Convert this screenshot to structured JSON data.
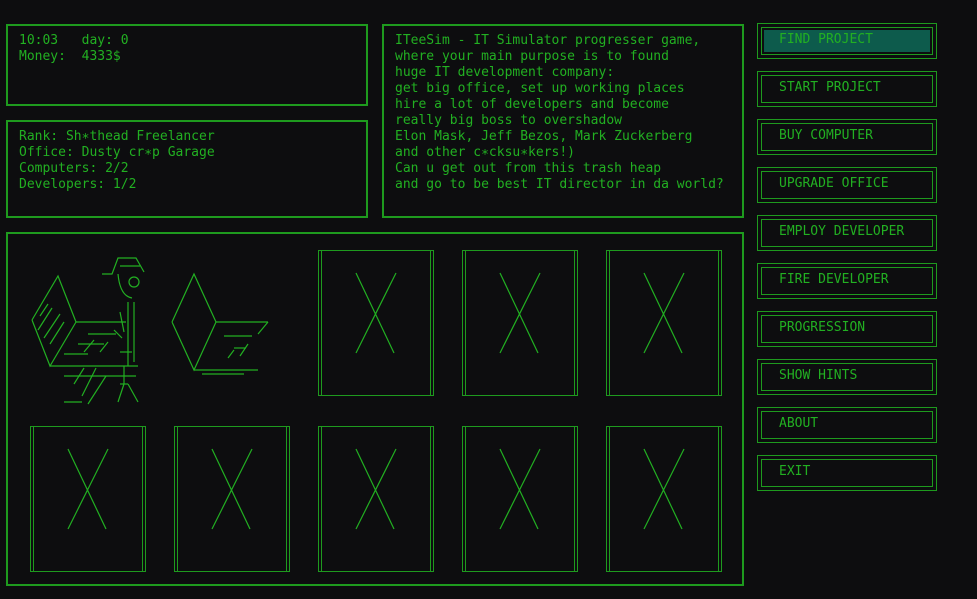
{
  "status": {
    "time": "10:03",
    "day_label": "day: 0",
    "money_label": "Money:",
    "money_value": "4333$"
  },
  "info": {
    "rank": "Rank: Sh∗thead Freelancer",
    "office": "Office: Dusty cr∗p Garage",
    "computers": "Computers: 2/2",
    "developers": "Developers: 1/2"
  },
  "description": [
    "ITeeSim - IT Simulator progresser game,",
    "where your main purpose is to found",
    "huge IT development company:",
    "get big office, set up working places",
    "hire a lot of developers and become",
    "really big boss to overshadow",
    "Elon Mask, Jeff Bezos, Mark Zuckerberg",
    "and other c∗cksu∗kers!)",
    "Can u get out from this trash heap",
    "and go to be best IT director in da world?"
  ],
  "menu": [
    {
      "label": "FIND PROJECT",
      "selected": true
    },
    {
      "label": "START PROJECT",
      "selected": false
    },
    {
      "label": "BUY COMPUTER",
      "selected": false
    },
    {
      "label": "UPGRADE OFFICE",
      "selected": false
    },
    {
      "label": "EMPLOY DEVELOPER",
      "selected": false
    },
    {
      "label": "FIRE DEVELOPER",
      "selected": false
    },
    {
      "label": "PROGRESSION",
      "selected": false
    },
    {
      "label": "SHOW HINTS",
      "selected": false
    },
    {
      "label": "ABOUT",
      "selected": false
    },
    {
      "label": "EXIT",
      "selected": false
    }
  ],
  "office_slots": [
    {
      "state": "developer-at-computer"
    },
    {
      "state": "empty-computer"
    },
    {
      "state": "locked"
    },
    {
      "state": "locked"
    },
    {
      "state": "locked"
    },
    {
      "state": "locked"
    },
    {
      "state": "locked"
    },
    {
      "state": "locked"
    },
    {
      "state": "locked"
    },
    {
      "state": "locked"
    }
  ],
  "colors": {
    "background": "#0d0d0f",
    "foreground": "#22b022",
    "border": "#1e9a1e",
    "highlight": "#0d5b4c"
  }
}
